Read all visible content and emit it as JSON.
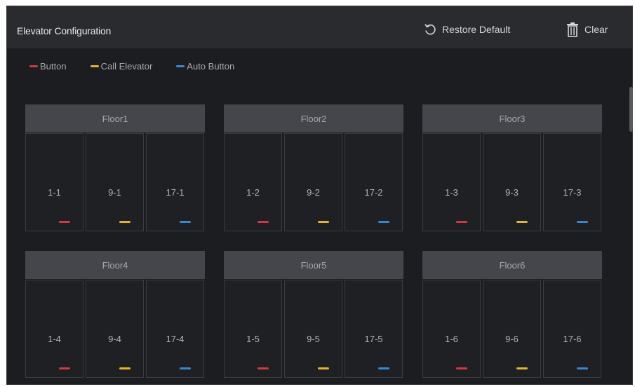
{
  "header": {
    "title": "Elevator Configuration",
    "restore_label": "Restore Default",
    "clear_label": "Clear"
  },
  "colors": {
    "button": "#d5363f",
    "call_elevator": "#e6b520",
    "auto_button": "#2f8bd6"
  },
  "legend": {
    "button": "Button",
    "call_elevator": "Call Elevator",
    "auto_button": "Auto Button"
  },
  "floors": [
    {
      "name": "Floor1",
      "cells": [
        {
          "label": "1-1",
          "type": "button"
        },
        {
          "label": "9-1",
          "type": "call_elevator"
        },
        {
          "label": "17-1",
          "type": "auto_button"
        }
      ]
    },
    {
      "name": "Floor2",
      "cells": [
        {
          "label": "1-2",
          "type": "button"
        },
        {
          "label": "9-2",
          "type": "call_elevator"
        },
        {
          "label": "17-2",
          "type": "auto_button"
        }
      ]
    },
    {
      "name": "Floor3",
      "cells": [
        {
          "label": "1-3",
          "type": "button"
        },
        {
          "label": "9-3",
          "type": "call_elevator"
        },
        {
          "label": "17-3",
          "type": "auto_button"
        }
      ]
    },
    {
      "name": "Floor4",
      "cells": [
        {
          "label": "1-4",
          "type": "button"
        },
        {
          "label": "9-4",
          "type": "call_elevator"
        },
        {
          "label": "17-4",
          "type": "auto_button"
        }
      ]
    },
    {
      "name": "Floor5",
      "cells": [
        {
          "label": "1-5",
          "type": "button"
        },
        {
          "label": "9-5",
          "type": "call_elevator"
        },
        {
          "label": "17-5",
          "type": "auto_button"
        }
      ]
    },
    {
      "name": "Floor6",
      "cells": [
        {
          "label": "1-6",
          "type": "button"
        },
        {
          "label": "9-6",
          "type": "call_elevator"
        },
        {
          "label": "17-6",
          "type": "auto_button"
        }
      ]
    }
  ]
}
